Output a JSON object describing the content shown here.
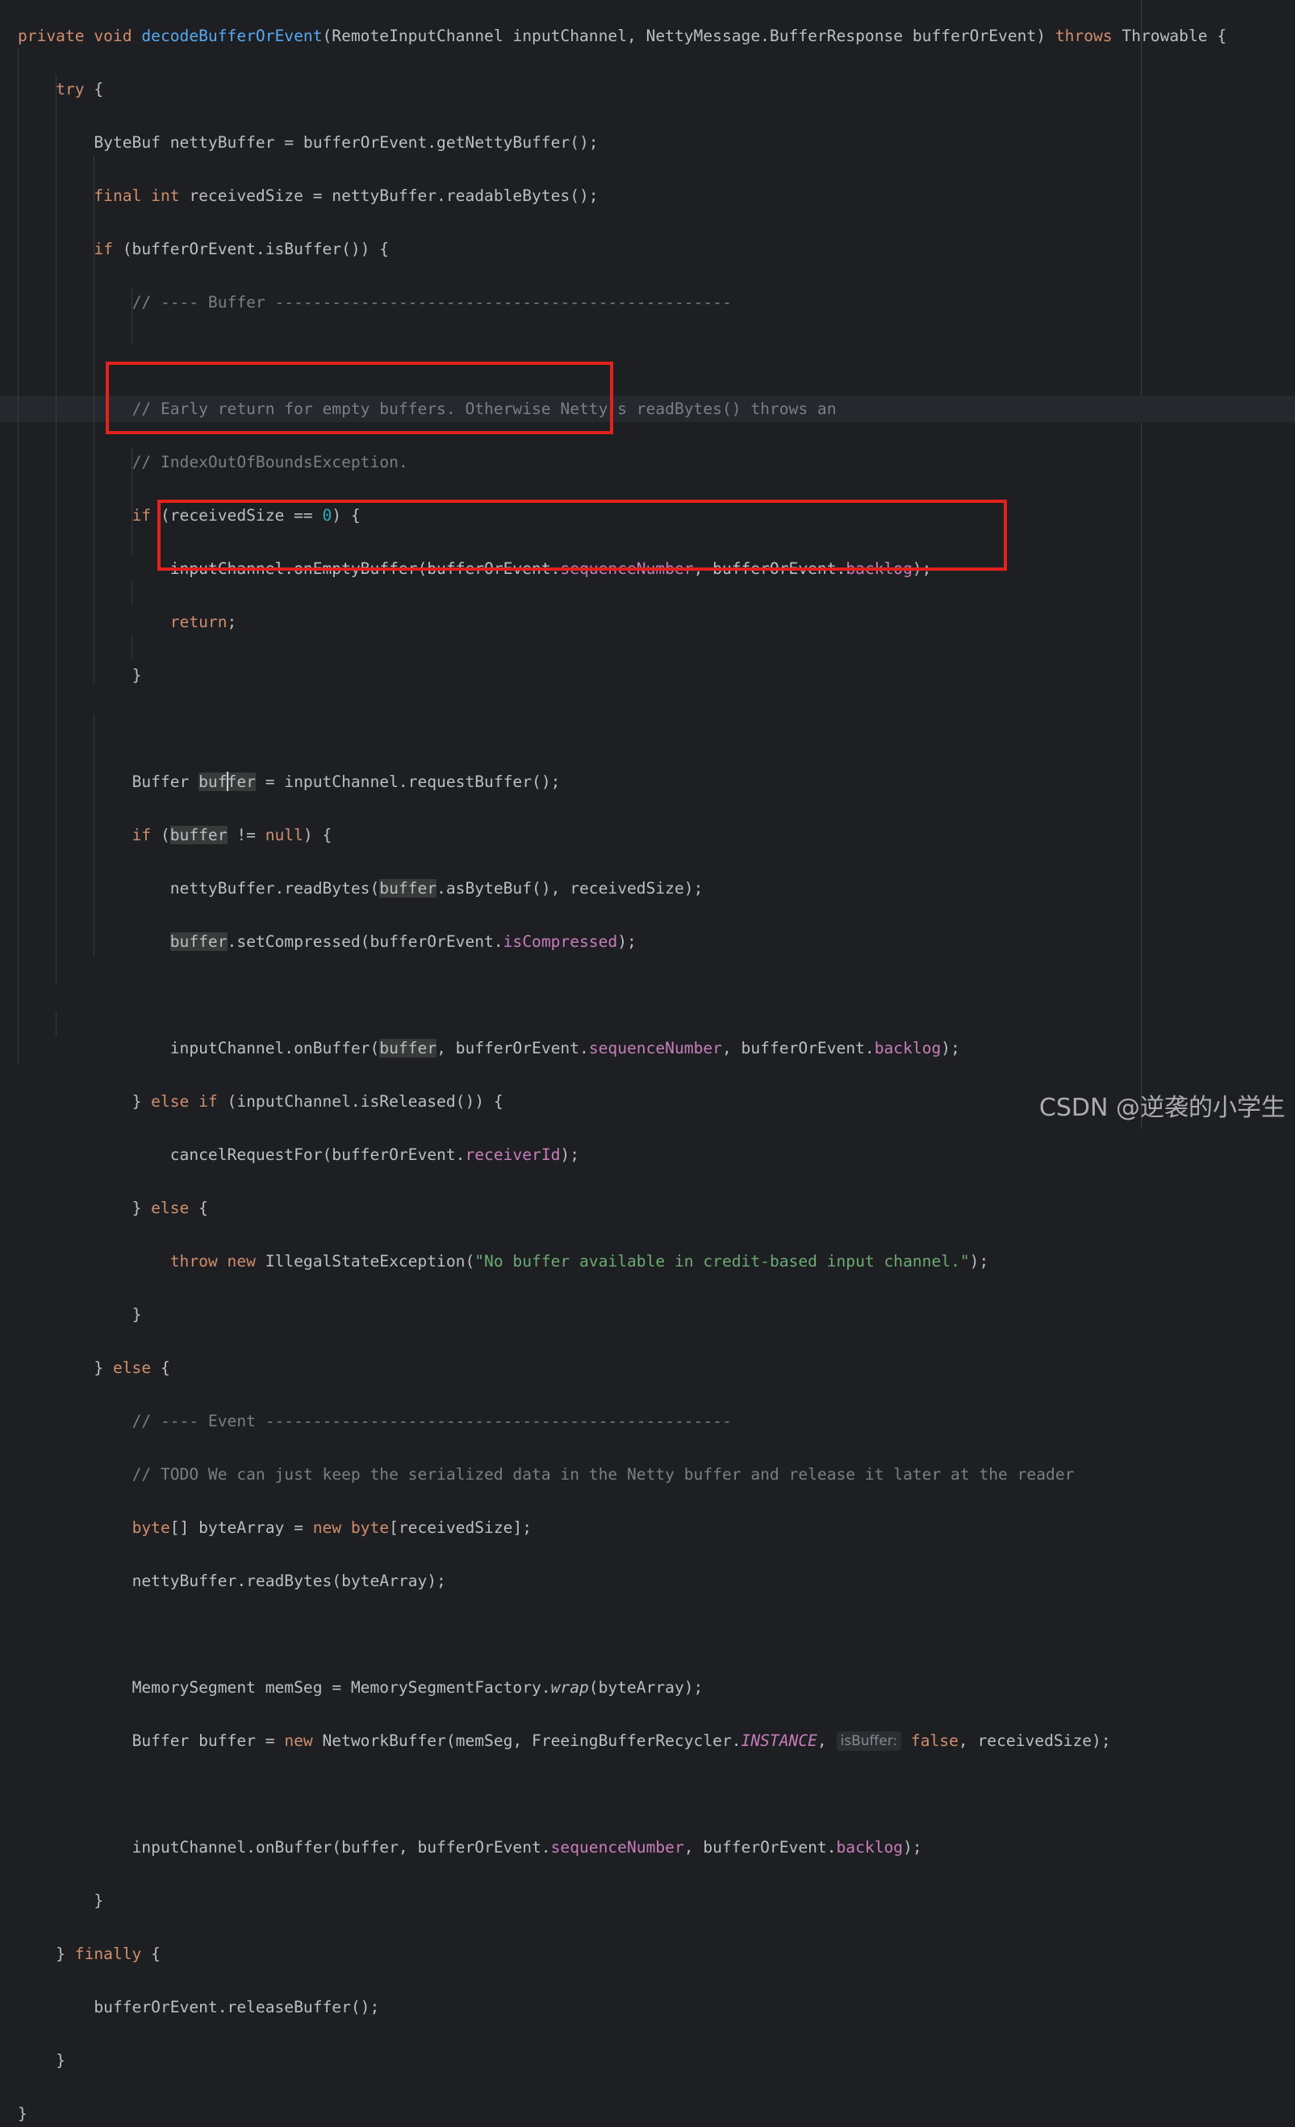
{
  "editor": {
    "theme_colors": {
      "background": "#1e1f22",
      "text": "#bcbec4",
      "keyword": "#cf8e6d",
      "method_declaration": "#56a8f5",
      "field": "#c77dbb",
      "string": "#6aab73",
      "comment": "#7a7e85",
      "number": "#2aacb8",
      "annotation_box": "#e3221c"
    },
    "inlay_hint": "isBuffer:"
  },
  "code": {
    "l1": [
      "private",
      "void",
      "decodeBufferOrEvent",
      "(RemoteInputChannel inputChannel, NettyMessage.BufferResponse bufferOrEvent) ",
      "throws",
      " Throwable {"
    ],
    "l2": [
      "try",
      " {"
    ],
    "l3": [
      "ByteBuf nettyBuffer = bufferOrEvent.getNettyBuffer();"
    ],
    "l4": [
      "final",
      "int",
      " receivedSize = nettyBuffer.readableBytes();"
    ],
    "l5": [
      "if",
      " (bufferOrEvent.isBuffer()) {"
    ],
    "l6": [
      "// ---- Buffer ------------------------------------------------"
    ],
    "l8": [
      "// Early return for empty buffers. Otherwise Netty's readBytes() throws an"
    ],
    "l9": [
      "// IndexOutOfBoundsException."
    ],
    "l10": [
      "if",
      " (receivedSize == ",
      "0",
      ") {"
    ],
    "l11": [
      "inputChannel.onEmptyBuffer(bufferOrEvent.",
      "sequenceNumber",
      ", bufferOrEvent.",
      "backlog",
      ");"
    ],
    "l12": [
      "return",
      ";"
    ],
    "l13": [
      "}"
    ],
    "l15": [
      "Buffer ",
      "buf",
      "fer",
      " = inputChannel.requestBuffer();"
    ],
    "l16": [
      "if",
      " (",
      "buffer",
      " != ",
      "null",
      ") {"
    ],
    "l17": [
      "nettyBuffer.readBytes(",
      "buffer",
      ".asByteBuf(), receivedSize);"
    ],
    "l18": [
      "buffer",
      ".setCompressed(bufferOrEvent.",
      "isCompressed",
      ");"
    ],
    "l20": [
      "inputChannel.onBuffer(",
      "buffer",
      ", bufferOrEvent.",
      "sequenceNumber",
      ", bufferOrEvent.",
      "backlog",
      ");"
    ],
    "l21": [
      "} ",
      "else if",
      " (inputChannel.isReleased()) {"
    ],
    "l22": [
      "cancelRequestFor(bufferOrEvent.",
      "receiverId",
      ");"
    ],
    "l23": [
      "} ",
      "else",
      " {"
    ],
    "l24": [
      "throw new",
      " IllegalStateException(",
      "\"No buffer available in credit-based input channel.\"",
      ");"
    ],
    "l25": [
      "}"
    ],
    "l26": [
      "} ",
      "else",
      " {"
    ],
    "l27": [
      "// ---- Event -------------------------------------------------"
    ],
    "l28": [
      "// TODO We can just keep the serialized data in the Netty buffer and release it later at the reader"
    ],
    "l29": [
      "byte",
      "[] byteArray = ",
      "new",
      "byte",
      "[receivedSize];"
    ],
    "l30": [
      "nettyBuffer.readBytes(byteArray);"
    ],
    "l32": [
      "MemorySegment memSeg = MemorySegmentFactory.",
      "wrap",
      "(byteArray);"
    ],
    "l33": [
      "Buffer buffer = ",
      "new",
      " NetworkBuffer(memSeg, FreeingBufferRecycler.",
      "INSTANCE",
      ", ",
      "false",
      ", receivedSize);"
    ],
    "l35": [
      "inputChannel.onBuffer(buffer, bufferOrEvent.",
      "sequenceNumber",
      ", bufferOrEvent.",
      "backlog",
      ");"
    ],
    "l36": [
      "}"
    ],
    "l37": [
      "} ",
      "finally",
      " {"
    ],
    "l38": [
      "bufferOrEvent.releaseBuffer();"
    ],
    "l39": [
      "}"
    ],
    "l40": [
      "}"
    ]
  },
  "watermark": "CSDN @逆袭的小学生"
}
